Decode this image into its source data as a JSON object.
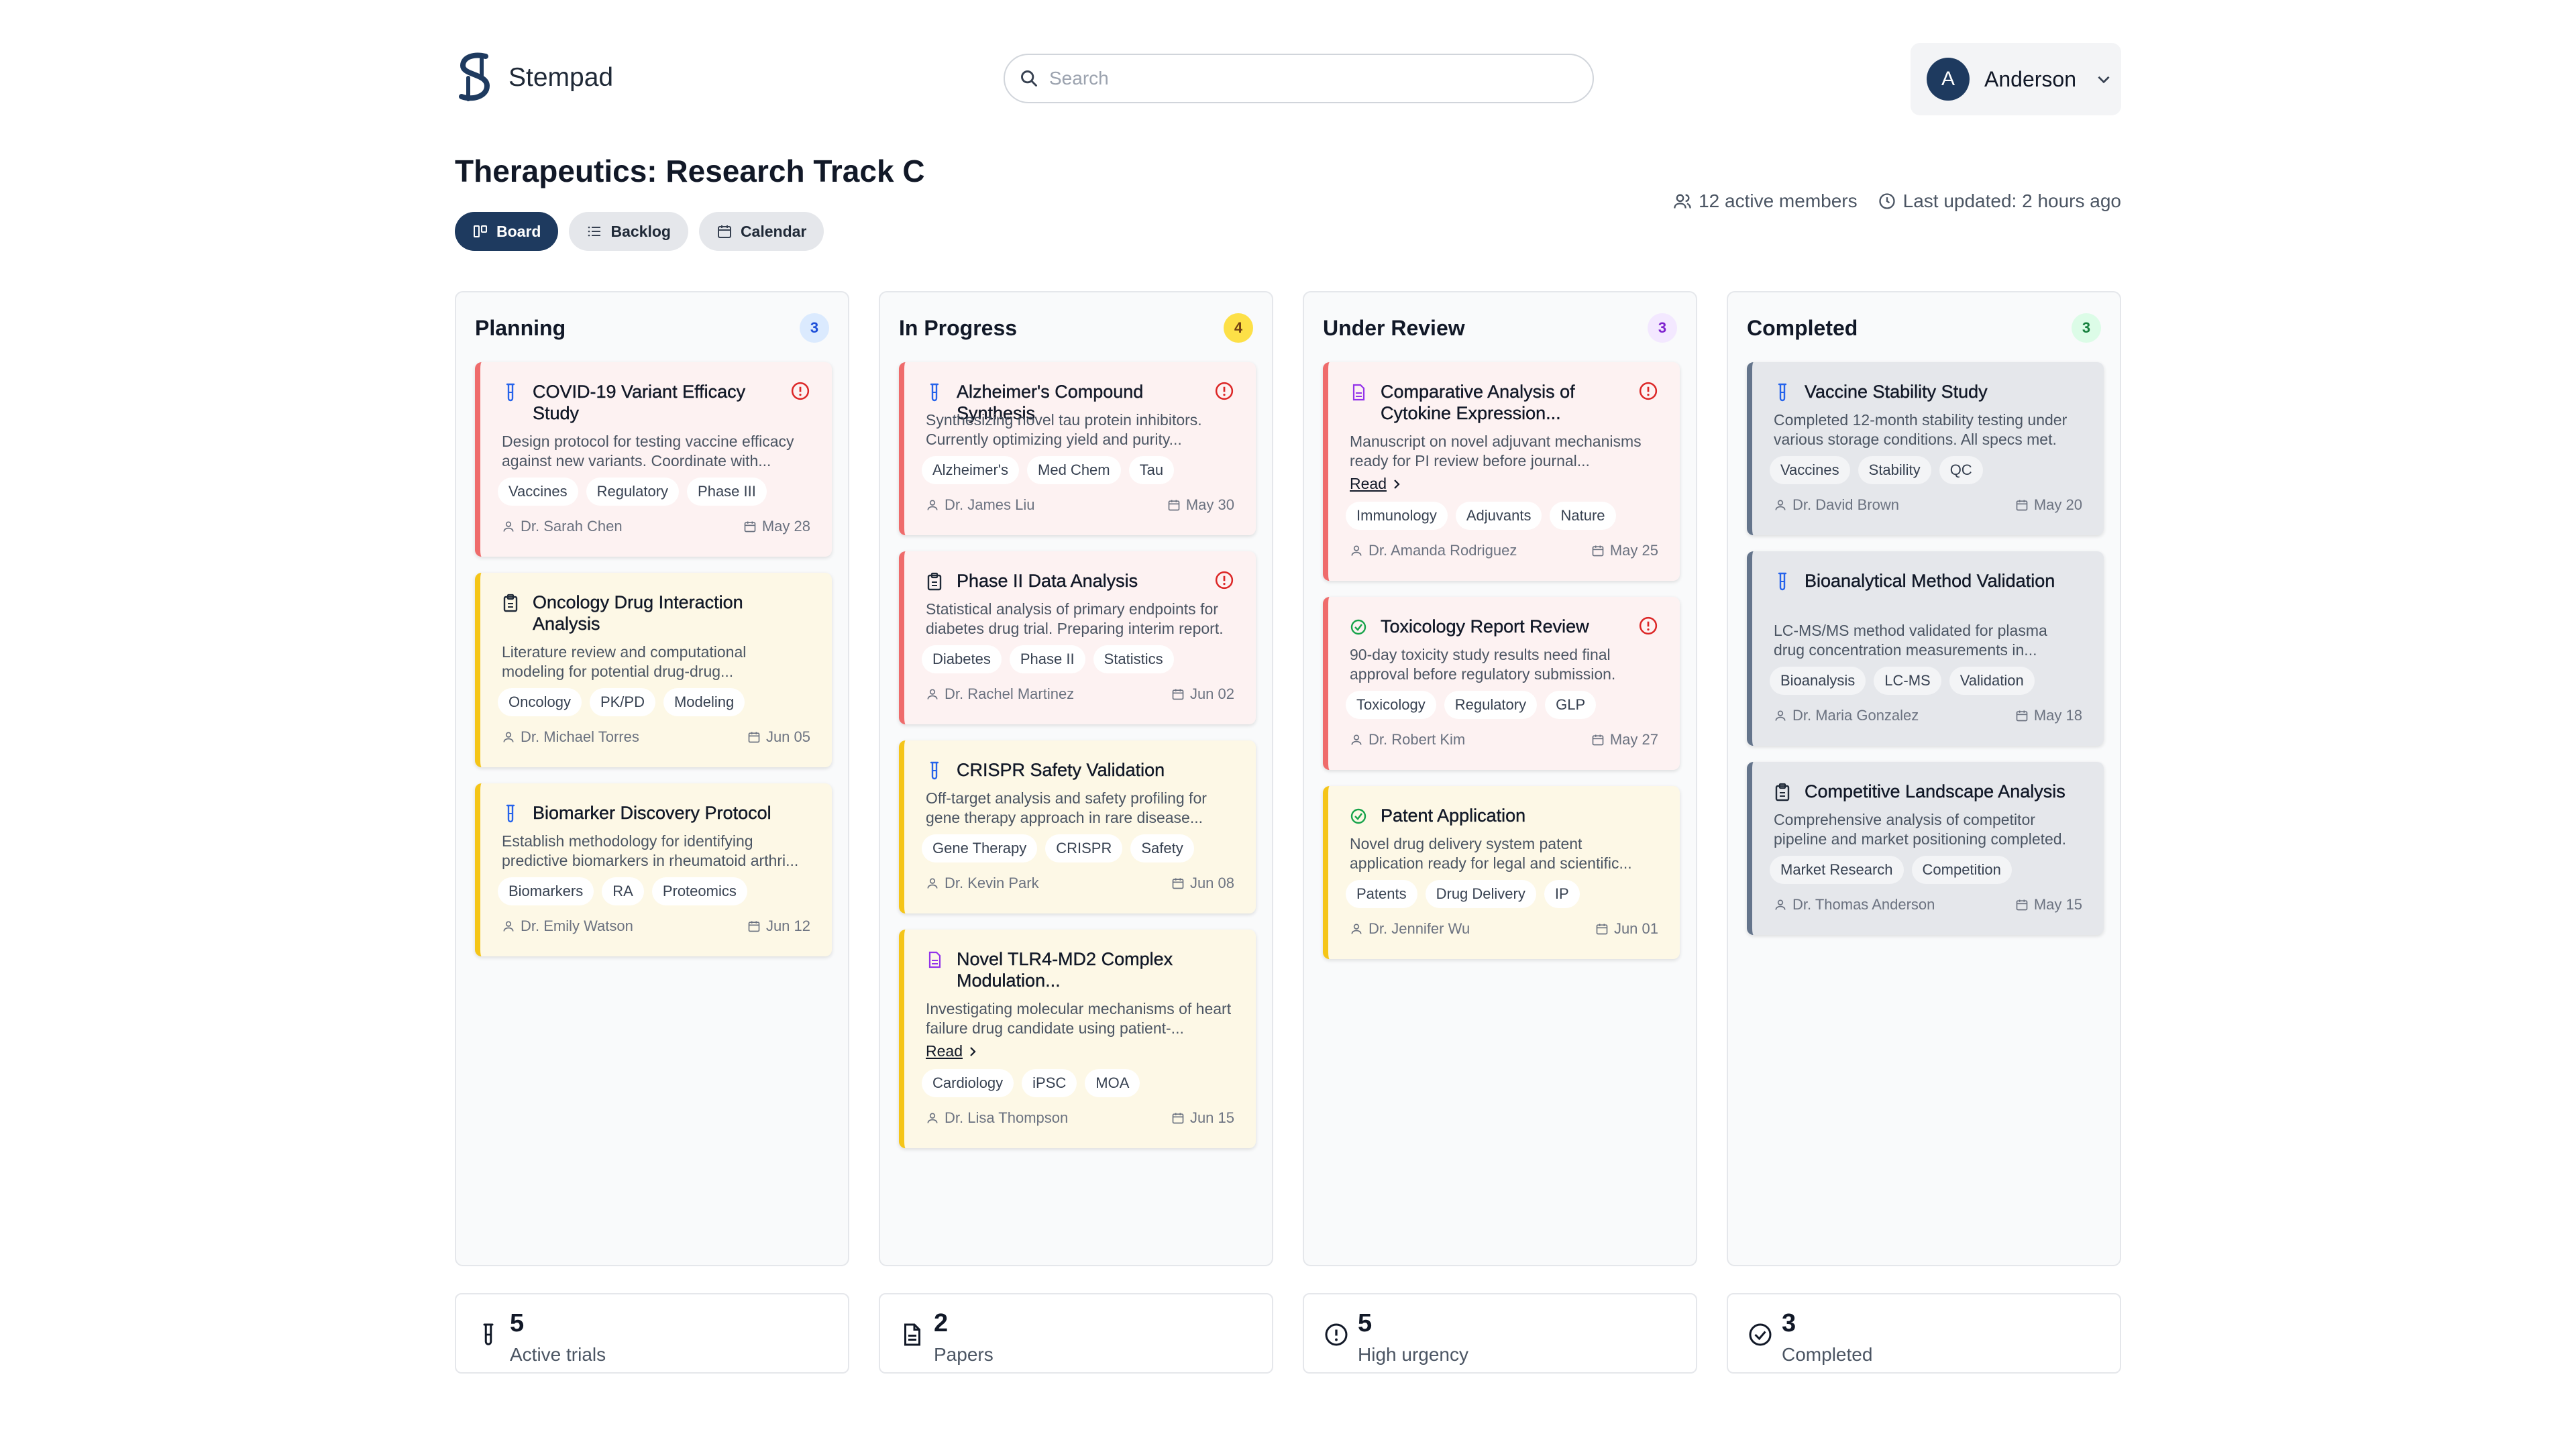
{
  "app": {
    "name": "Stempad"
  },
  "search": {
    "placeholder": "Search"
  },
  "user": {
    "initial": "A",
    "name": "Anderson"
  },
  "page": {
    "title": "Therapeutics: Research Track C"
  },
  "views": [
    {
      "label": "Board",
      "icon": "board-icon",
      "active": true
    },
    {
      "label": "Backlog",
      "icon": "list-icon",
      "active": false
    },
    {
      "label": "Calendar",
      "icon": "calendar-icon",
      "active": false
    }
  ],
  "meta": {
    "members": "12 active members",
    "updated": "Last updated: 2 hours ago"
  },
  "columns": [
    {
      "title": "Planning",
      "count": "3",
      "count_bg": "#dbeafe",
      "count_fg": "#1d4ed8",
      "cards": [
        {
          "title": "COVID-19 Variant Efficacy Study",
          "icon": "test-tube-icon",
          "alert": true,
          "style": "red",
          "desc": "Design protocol for testing vaccine efficacy against new variants. Coordinate with...",
          "read": "",
          "tags": [
            "Vaccines",
            "Regulatory",
            "Phase III"
          ],
          "owner": "Dr. Sarah Chen",
          "date": "May 28"
        },
        {
          "title": "Oncology Drug Interaction Analysis",
          "icon": "clipboard-icon",
          "alert": false,
          "style": "yellow",
          "desc": "Literature review and computational modeling for potential drug-drug...",
          "read": "",
          "tags": [
            "Oncology",
            "PK/PD",
            "Modeling"
          ],
          "owner": "Dr. Michael Torres",
          "date": "Jun 05"
        },
        {
          "title": "Biomarker Discovery Protocol",
          "icon": "test-tube-icon",
          "alert": false,
          "style": "yellow",
          "desc": "Establish methodology for identifying predictive biomarkers in rheumatoid arthri...",
          "read": "",
          "tags": [
            "Biomarkers",
            "RA",
            "Proteomics"
          ],
          "owner": "Dr. Emily Watson",
          "date": "Jun 12"
        }
      ]
    },
    {
      "title": "In Progress",
      "count": "4",
      "count_bg": "#fde047",
      "count_fg": "#713f12",
      "cards": [
        {
          "title": "Alzheimer's Compound Synthesis",
          "icon": "test-tube-icon",
          "alert": true,
          "style": "red",
          "desc": "Synthesizing novel tau protein inhibitors. Currently optimizing yield and purity...",
          "read": "",
          "tags": [
            "Alzheimer's",
            "Med Chem",
            "Tau"
          ],
          "owner": "Dr. James Liu",
          "date": "May 30"
        },
        {
          "title": "Phase II Data Analysis",
          "icon": "clipboard-icon",
          "alert": true,
          "style": "red",
          "desc": "Statistical analysis of primary endpoints for diabetes drug trial. Preparing interim report.",
          "read": "",
          "tags": [
            "Diabetes",
            "Phase II",
            "Statistics"
          ],
          "owner": "Dr. Rachel Martinez",
          "date": "Jun 02"
        },
        {
          "title": "CRISPR Safety Validation",
          "icon": "test-tube-icon",
          "alert": false,
          "style": "yellow",
          "desc": "Off-target analysis and safety profiling for gene therapy approach in rare disease...",
          "read": "",
          "tags": [
            "Gene Therapy",
            "CRISPR",
            "Safety"
          ],
          "owner": "Dr. Kevin Park",
          "date": "Jun 08"
        },
        {
          "title": "Novel TLR4-MD2 Complex Modulation...",
          "icon": "document-icon",
          "alert": false,
          "style": "yellow",
          "desc": "Investigating molecular mechanisms of heart failure drug candidate using patient-...",
          "read": "Read",
          "tags": [
            "Cardiology",
            "iPSC",
            "MOA"
          ],
          "owner": "Dr. Lisa Thompson",
          "date": "Jun 15"
        }
      ]
    },
    {
      "title": "Under Review",
      "count": "3",
      "count_bg": "#f3e8ff",
      "count_fg": "#7e22ce",
      "cards": [
        {
          "title": "Comparative Analysis of Cytokine Expression...",
          "icon": "document-icon",
          "alert": true,
          "style": "red",
          "desc": "Manuscript on novel adjuvant mechanisms ready for PI review before journal...",
          "read": "Read",
          "tags": [
            "Immunology",
            "Adjuvants",
            "Nature"
          ],
          "owner": "Dr. Amanda Rodriguez",
          "date": "May 25"
        },
        {
          "title": "Toxicology Report Review",
          "icon": "check-circle-icon",
          "alert": true,
          "style": "red",
          "desc": "90-day toxicity study results need final approval before regulatory submission.",
          "read": "",
          "tags": [
            "Toxicology",
            "Regulatory",
            "GLP"
          ],
          "owner": "Dr. Robert Kim",
          "date": "May 27"
        },
        {
          "title": "Patent Application",
          "icon": "check-circle-icon",
          "alert": false,
          "style": "yellow",
          "desc": "Novel drug delivery system patent application ready for legal and scientific...",
          "read": "",
          "tags": [
            "Patents",
            "Drug Delivery",
            "IP"
          ],
          "owner": "Dr. Jennifer Wu",
          "date": "Jun 01"
        }
      ]
    },
    {
      "title": "Completed",
      "count": "3",
      "count_bg": "#dcfce7",
      "count_fg": "#15803d",
      "cards": [
        {
          "title": "Vaccine Stability Study",
          "icon": "test-tube-icon",
          "alert": false,
          "style": "gray",
          "desc": "Completed 12-month stability testing under various storage conditions. All specs met.",
          "read": "",
          "tags": [
            "Vaccines",
            "Stability",
            "QC"
          ],
          "owner": "Dr. David Brown",
          "date": "May 20"
        },
        {
          "title": "Bioanalytical Method Validation",
          "icon": "test-tube-icon",
          "alert": false,
          "style": "gray",
          "desc": "LC-MS/MS method validated for plasma drug concentration measurements in...",
          "read": "",
          "tags": [
            "Bioanalysis",
            "LC-MS",
            "Validation"
          ],
          "owner": "Dr. Maria Gonzalez",
          "date": "May 18"
        },
        {
          "title": "Competitive Landscape Analysis",
          "icon": "clipboard-icon",
          "alert": false,
          "style": "gray",
          "desc": "Comprehensive analysis of competitor pipeline and market positioning completed.",
          "read": "",
          "tags": [
            "Market Research",
            "Competition"
          ],
          "owner": "Dr. Thomas Anderson",
          "date": "May 15"
        }
      ]
    }
  ],
  "stats": [
    {
      "value": "5",
      "label": "Active trials",
      "icon": "test-tube-icon"
    },
    {
      "value": "2",
      "label": "Papers",
      "icon": "document-icon"
    },
    {
      "value": "5",
      "label": "High urgency",
      "icon": "alert-circle-icon"
    },
    {
      "value": "3",
      "label": "Completed",
      "icon": "check-circle-icon"
    }
  ],
  "colors": {
    "accent": "#1e3a5f",
    "alert": "#dc2626",
    "success": "#16a34a",
    "test_tube": "#2563eb",
    "document": "#9333ea"
  }
}
